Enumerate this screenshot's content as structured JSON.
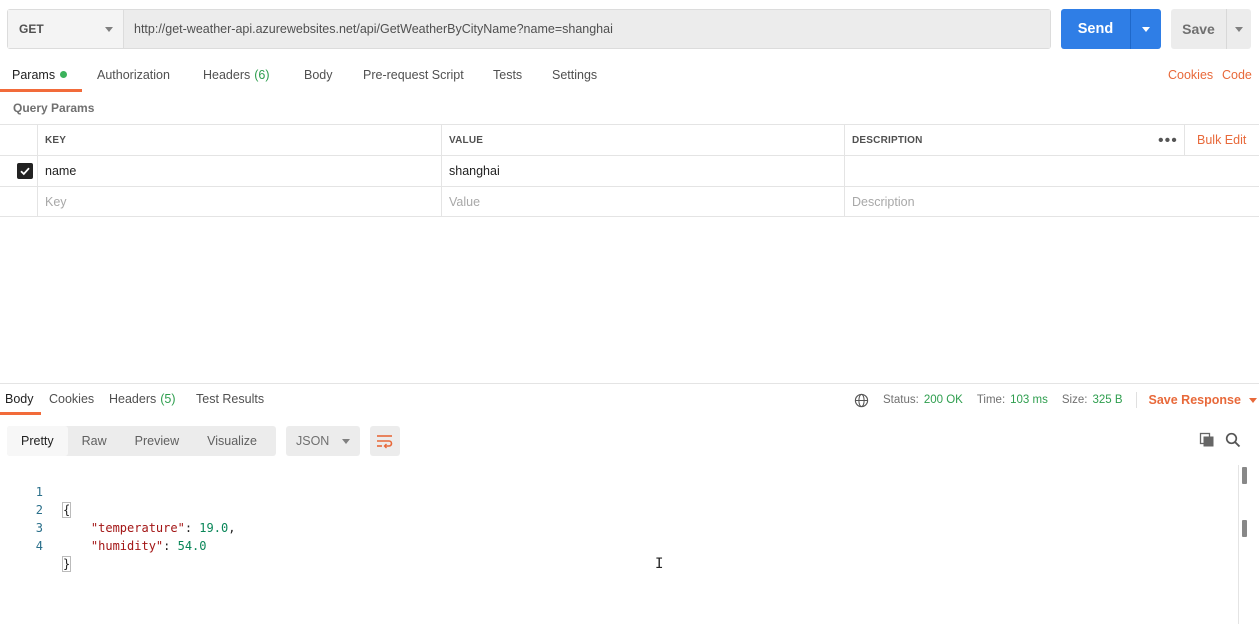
{
  "request": {
    "method": "GET",
    "url": "http://get-weather-api.azurewebsites.net/api/GetWeatherByCityName?name=shanghai",
    "send_label": "Send",
    "save_label": "Save"
  },
  "request_tabs": {
    "params": "Params",
    "authorization": "Authorization",
    "headers": "Headers",
    "headers_count": "(6)",
    "body": "Body",
    "pre_request": "Pre-request Script",
    "tests": "Tests",
    "settings": "Settings",
    "cookies": "Cookies",
    "code": "Code"
  },
  "query_params": {
    "title": "Query Params",
    "headers": {
      "key": "KEY",
      "value": "VALUE",
      "description": "DESCRIPTION"
    },
    "bulk_edit": "Bulk Edit",
    "rows": [
      {
        "checked": true,
        "key": "name",
        "value": "shanghai",
        "description": ""
      }
    ],
    "placeholders": {
      "key": "Key",
      "value": "Value",
      "description": "Description"
    }
  },
  "response_tabs": {
    "body": "Body",
    "cookies": "Cookies",
    "headers": "Headers",
    "headers_count": "(5)",
    "test_results": "Test Results"
  },
  "response_status": {
    "status_label": "Status:",
    "status_value": "200 OK",
    "time_label": "Time:",
    "time_value": "103 ms",
    "size_label": "Size:",
    "size_value": "325 B",
    "save_response": "Save Response"
  },
  "body_toolbar": {
    "formats": [
      "Pretty",
      "Raw",
      "Preview",
      "Visualize"
    ],
    "active_format": "Pretty",
    "language": "JSON"
  },
  "response_body": {
    "line_numbers": [
      "1",
      "2",
      "3",
      "4"
    ],
    "open_brace": "{",
    "close_brace": "}",
    "fields": [
      {
        "key": "\"temperature\"",
        "value": "19.0",
        "trailing": ","
      },
      {
        "key": "\"humidity\"",
        "value": "54.0",
        "trailing": ""
      }
    ]
  },
  "colors": {
    "accent_orange": "#f26b3a",
    "send_blue": "#2f7ee6",
    "status_green": "#2e9e4e"
  }
}
